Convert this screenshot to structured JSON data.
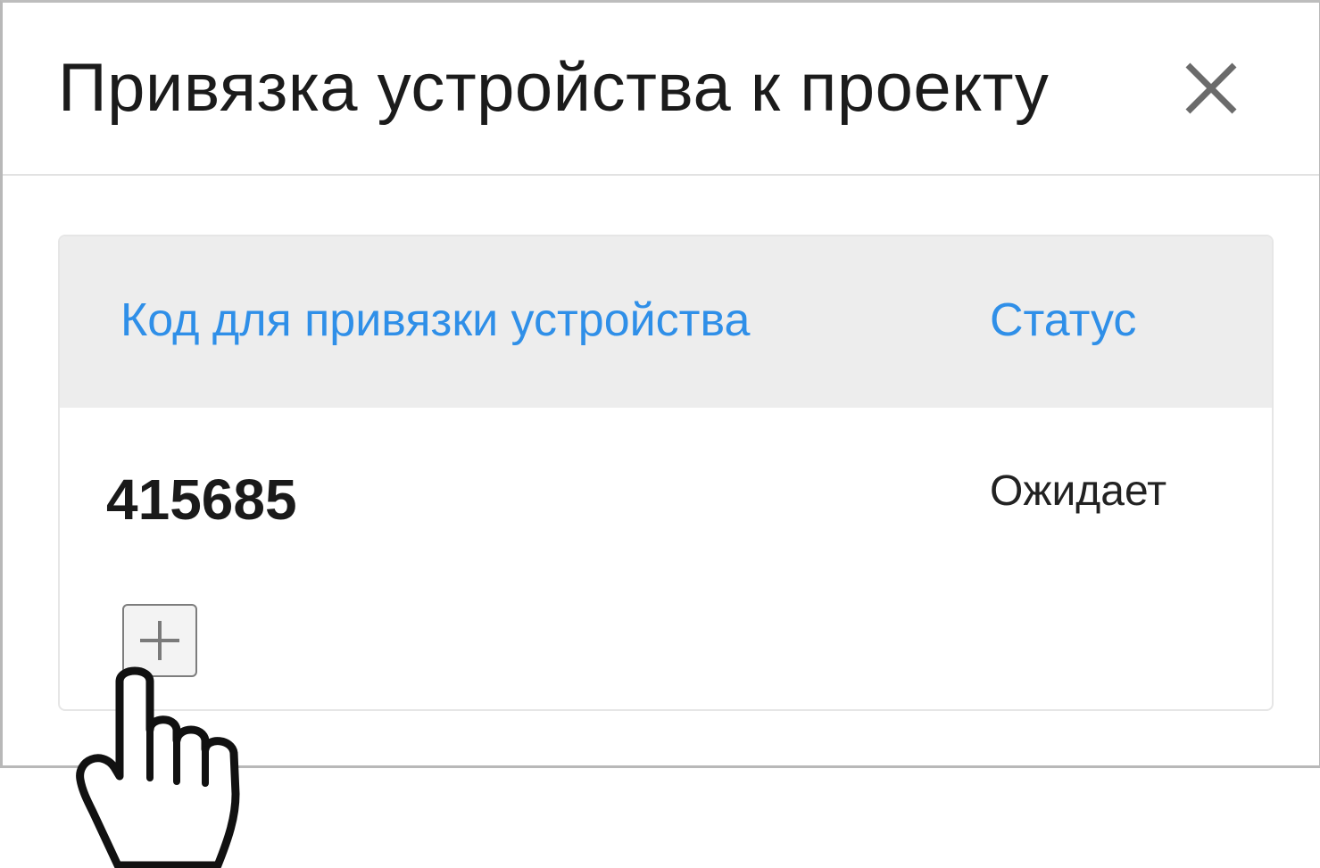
{
  "dialog": {
    "title": "Привязка устройства к проекту",
    "close_icon": "close-icon"
  },
  "table": {
    "headers": {
      "code": "Код для привязки устройства",
      "status": "Статус"
    },
    "rows": [
      {
        "code": "415685",
        "status": "Ожидает"
      }
    ]
  },
  "actions": {
    "add_icon": "plus-icon"
  },
  "cursor": {
    "icon": "hand-pointer-icon"
  },
  "colors": {
    "header_link": "#2f8fe8",
    "table_header_bg": "#ededed",
    "title_text": "#1b1b1b"
  }
}
